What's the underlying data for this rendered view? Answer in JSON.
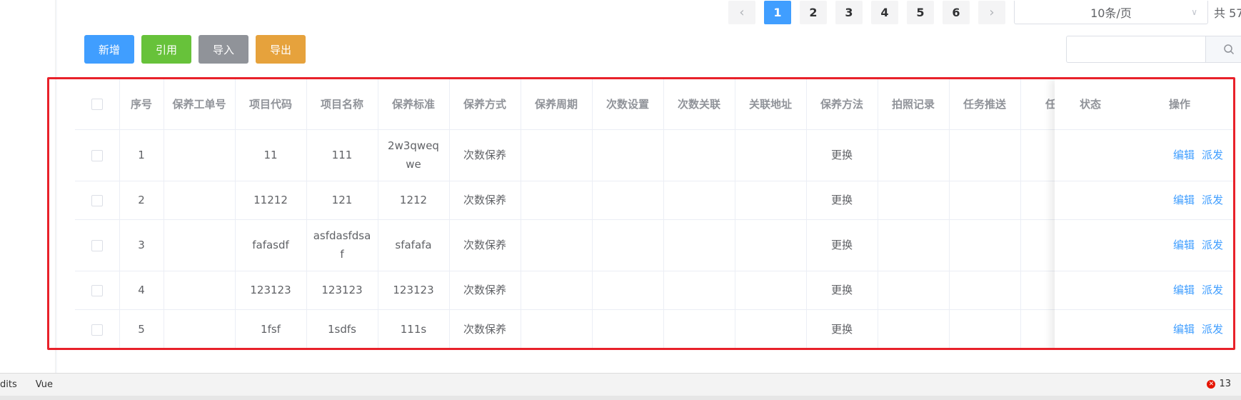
{
  "pagination": {
    "prev_icon": "chevron-left-icon",
    "next_icon": "chevron-right-icon",
    "pages": [
      "1",
      "2",
      "3",
      "4",
      "5",
      "6"
    ],
    "active_page": "1",
    "page_size": "10条/页",
    "total_text": "共 57"
  },
  "toolbar": {
    "add_label": "新增",
    "reference_label": "引用",
    "import_label": "导入",
    "export_label": "导出"
  },
  "search": {
    "placeholder": "",
    "icon": "search-icon"
  },
  "table": {
    "headers": [
      "序号",
      "保养工单号",
      "项目代码",
      "项目名称",
      "保养标准",
      "保养方式",
      "保养周期",
      "次数设置",
      "次数关联",
      "关联地址",
      "保养方法",
      "拍照记录",
      "任务推送",
      "任务"
    ],
    "fixed_headers": [
      "状态",
      "操作"
    ],
    "rows": [
      {
        "seq": "1",
        "order": "",
        "code": "11",
        "name": "111",
        "standard": "2w3qweqwe",
        "mode": "次数保养",
        "method": "更换"
      },
      {
        "seq": "2",
        "order": "",
        "code": "11212",
        "name": "121",
        "standard": "1212",
        "mode": "次数保养",
        "method": "更换"
      },
      {
        "seq": "3",
        "order": "",
        "code": "fafasdf",
        "name": "asfdasfdsaf",
        "standard": "sfafafa",
        "mode": "次数保养",
        "method": "更换"
      },
      {
        "seq": "4",
        "order": "",
        "code": "123123",
        "name": "123123",
        "standard": "123123",
        "mode": "次数保养",
        "method": "更换"
      },
      {
        "seq": "5",
        "order": "",
        "code": "1fsf",
        "name": "1sdfs",
        "standard": "111s",
        "mode": "次数保养",
        "method": "更换"
      }
    ],
    "edit_label": "编辑",
    "dispatch_label": "派发"
  },
  "statusbar": {
    "left_text": "dits",
    "vue_label": "Vue",
    "error_count": "13"
  },
  "colors": {
    "primary": "#409eff",
    "success": "#67c23a",
    "info": "#909399",
    "warning": "#e6a23c",
    "highlight": "#e8212a"
  }
}
